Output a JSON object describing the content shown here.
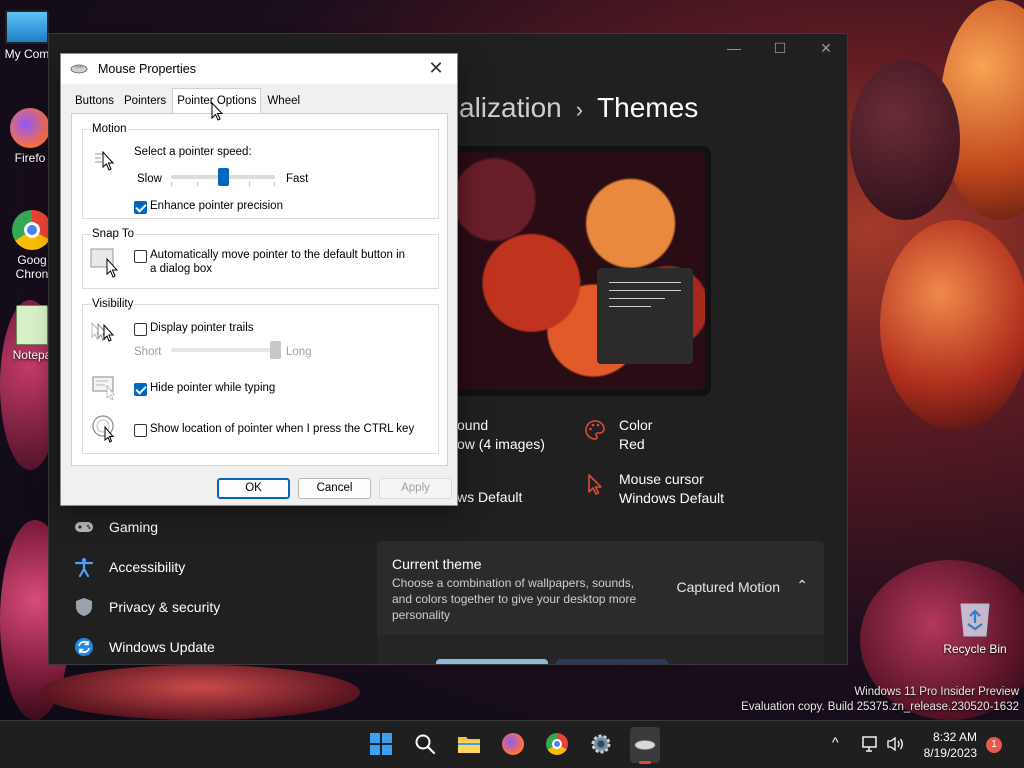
{
  "desktop": {
    "icons": [
      {
        "label": "My Com",
        "name": "my-computer"
      },
      {
        "label": "Firefo",
        "name": "firefox"
      },
      {
        "label": "Goog",
        "label2": "Chron",
        "name": "google-chrome"
      },
      {
        "label": "Notepa",
        "name": "notepad"
      }
    ],
    "recycle_bin": "Recycle Bin",
    "watermark": {
      "line1": "Windows 11 Pro Insider Preview",
      "line2": "Evaluation copy. Build 25375.zn_release.230520-1632"
    }
  },
  "settings": {
    "breadcrumb_parent": "alization",
    "breadcrumb_sep": "›",
    "breadcrumb_current": "Themes",
    "window_controls": {
      "minimize": "—",
      "maximize": "☐",
      "close": "✕"
    },
    "props": {
      "background_label": "ound",
      "background_value": "ow (4 images)",
      "sounds_value": "ws Default",
      "color_label": "Color",
      "color_value": "Red",
      "cursor_label": "Mouse cursor",
      "cursor_value": "Windows Default"
    },
    "nav": [
      {
        "label": "Gaming",
        "icon": "gamepad-icon"
      },
      {
        "label": "Accessibility",
        "icon": "accessibility-icon"
      },
      {
        "label": "Privacy & security",
        "icon": "shield-icon"
      },
      {
        "label": "Windows Update",
        "icon": "update-icon"
      }
    ],
    "current_theme": {
      "title": "Current theme",
      "description": "Choose a combination of wallpapers, sounds, and colors together to give your desktop more personality",
      "value": "Captured Motion",
      "chevron": "⌃"
    }
  },
  "dialog": {
    "title": "Mouse Properties",
    "close": "✕",
    "tabs": [
      "Buttons",
      "Pointers",
      "Pointer Options",
      "Wheel"
    ],
    "active_tab": "Pointer Options",
    "motion": {
      "legend": "Motion",
      "prompt": "Select a pointer speed:",
      "slow": "Slow",
      "fast": "Fast",
      "speed_level": 0.5,
      "precision_label": "Enhance pointer precision",
      "precision_checked": true
    },
    "snap_to": {
      "legend": "Snap To",
      "label": "Automatically move pointer to the default button in a dialog box",
      "checked": false
    },
    "visibility": {
      "legend": "Visibility",
      "trails_label": "Display pointer trails",
      "trails_checked": false,
      "short": "Short",
      "long": "Long",
      "trails_level": 1.0,
      "hide_label": "Hide pointer while typing",
      "hide_checked": true,
      "ctrl_label": "Show location of pointer when I press the CTRL key",
      "ctrl_checked": false
    },
    "buttons": {
      "ok": "OK",
      "cancel": "Cancel",
      "apply": "Apply"
    }
  },
  "taskbar": {
    "clock_time": "8:32 AM",
    "clock_date": "8/19/2023",
    "notification_count": "1",
    "tray_chevron": "^"
  },
  "colors": {
    "accent": "#0067c0",
    "settings_bg": "#202020",
    "cursor_red": "#e0483a"
  }
}
